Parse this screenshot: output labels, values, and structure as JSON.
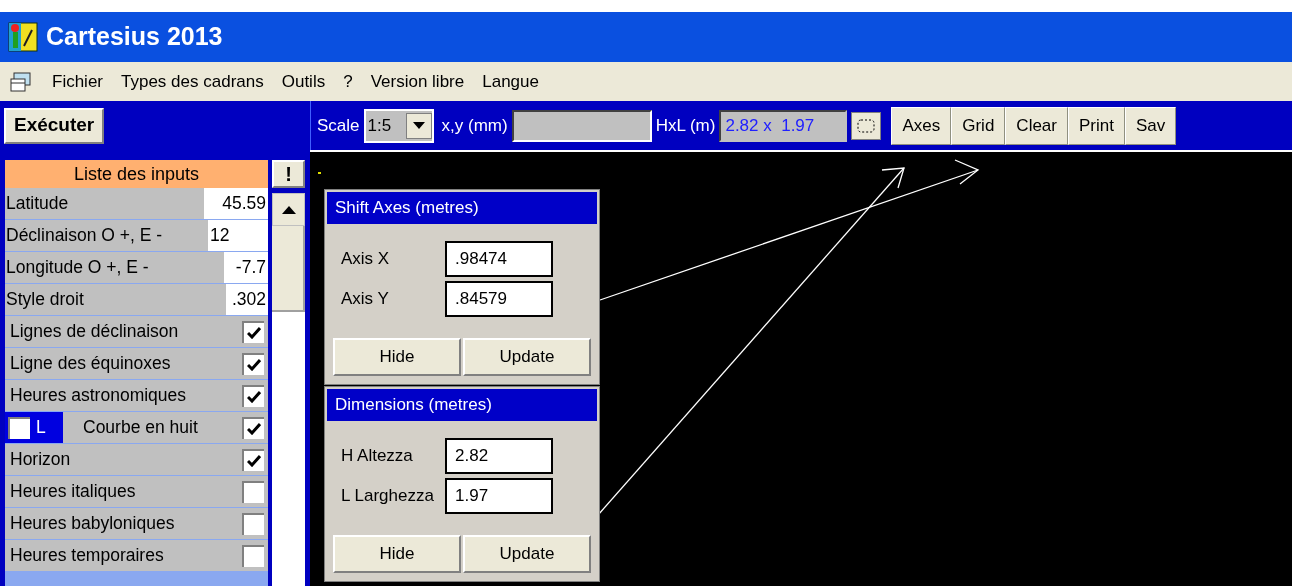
{
  "window": {
    "title": "Cartesius 2013"
  },
  "menu": [
    "Fichier",
    "Types des cadrans",
    "Outils",
    "?",
    "Version libre",
    "Langue"
  ],
  "toolbar": {
    "execute": "Exécuter",
    "scale_label": "Scale",
    "scale_value": "1:5",
    "xy_label": "x,y (mm)",
    "hxl_label": "HxL (m)",
    "hxl_value": "2.82 x  1.97",
    "buttons": [
      "Axes",
      "Grid",
      "Clear",
      "Print",
      "Sav"
    ]
  },
  "inputs": {
    "title": "Liste des inputs",
    "bang": "!",
    "rows": [
      {
        "kind": "value",
        "label": "Latitude",
        "value": "45.59"
      },
      {
        "kind": "value",
        "label": "Déclinaison O +, E -",
        "value": "12"
      },
      {
        "kind": "value",
        "label": "Longitude O +, E -",
        "value": "-7.7"
      },
      {
        "kind": "value",
        "label": "Style droit",
        "value": ".302"
      },
      {
        "kind": "check",
        "label": "Lignes de déclinaison",
        "checked": true
      },
      {
        "kind": "check",
        "label": "Ligne des équinoxes",
        "checked": true
      },
      {
        "kind": "check",
        "label": "Heures astronomiques",
        "checked": true
      },
      {
        "kind": "check_l",
        "label": "Courbe en huit",
        "l_label": "L",
        "l_checked": false,
        "checked": true
      },
      {
        "kind": "check",
        "label": "Horizon",
        "checked": true
      },
      {
        "kind": "check",
        "label": "Heures italiques",
        "checked": false
      },
      {
        "kind": "check",
        "label": "Heures babyloniques",
        "checked": false
      },
      {
        "kind": "check",
        "label": "Heures temporaires",
        "checked": false
      }
    ]
  },
  "dialogs": [
    {
      "title": "Shift Axes (metres)",
      "fields": [
        {
          "label": "Axis X",
          "value": ".98474"
        },
        {
          "label": "Axis Y",
          "value": ".84579"
        }
      ],
      "buttons": [
        "Hide",
        "Update"
      ]
    },
    {
      "title": "Dimensions (metres)",
      "fields": [
        {
          "label": "H Altezza",
          "value": "2.82"
        },
        {
          "label": "L Larghezza",
          "value": "1.97"
        }
      ],
      "buttons": [
        "Hide",
        "Update"
      ]
    }
  ]
}
